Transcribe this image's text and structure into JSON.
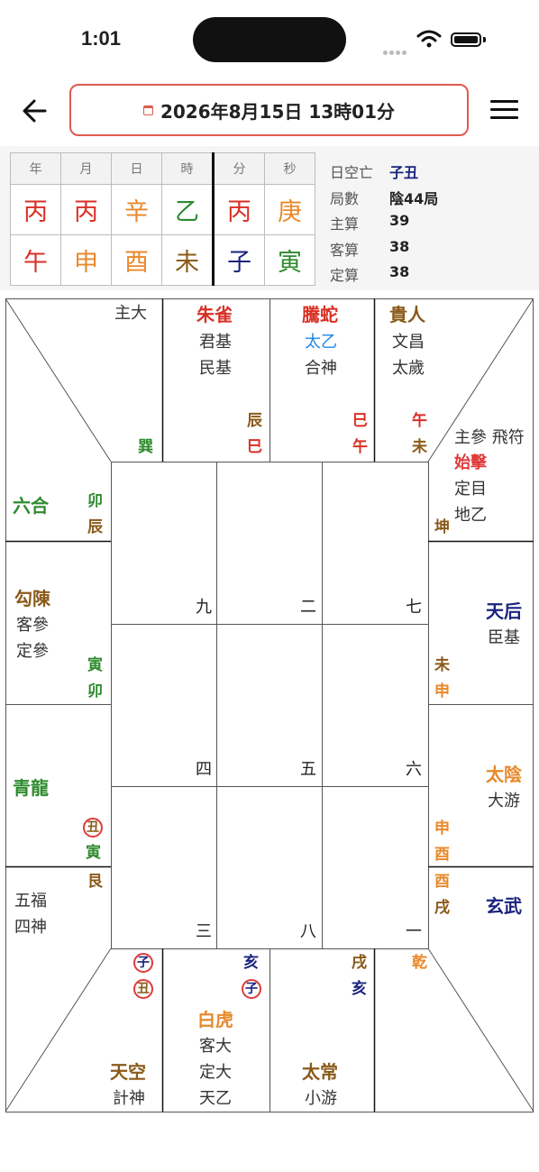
{
  "status_bar": {
    "time": "1:01"
  },
  "header": {
    "date_text": "2026年8月15日 13時01分"
  },
  "bazi": {
    "headers": [
      "年",
      "月",
      "日",
      "時",
      "分",
      "秒"
    ],
    "stems": [
      {
        "c": "丙",
        "color": "#d93025"
      },
      {
        "c": "丙",
        "color": "#d93025"
      },
      {
        "c": "辛",
        "color": "#e8892b"
      },
      {
        "c": "乙",
        "color": "#2e8b2e"
      },
      {
        "c": "丙",
        "color": "#d93025"
      },
      {
        "c": "庚",
        "color": "#e8892b"
      }
    ],
    "branches": [
      {
        "c": "午",
        "color": "#d93025"
      },
      {
        "c": "申",
        "color": "#e8892b"
      },
      {
        "c": "酉",
        "color": "#e8892b"
      },
      {
        "c": "未",
        "color": "#8a5a1a"
      },
      {
        "c": "子",
        "color": "#1a237e"
      },
      {
        "c": "寅",
        "color": "#2e8b2e"
      }
    ]
  },
  "info": [
    {
      "label": "日空亡",
      "value": "子丑",
      "color": "#1a237e"
    },
    {
      "label": "局數",
      "value": "陰44局",
      "color": "#222"
    },
    {
      "label": "主算",
      "value": "39",
      "color": "#222"
    },
    {
      "label": "客算",
      "value": "38",
      "color": "#222"
    },
    {
      "label": "定算",
      "value": "38",
      "color": "#222"
    }
  ],
  "colors": {
    "red": "#d93025",
    "orange": "#e8892b",
    "green": "#2e8b2e",
    "brown": "#8a5a1a",
    "navy": "#1a237e",
    "blue": "#1e88e5"
  },
  "palaces": {
    "p1": {
      "stars": [
        "主大"
      ],
      "branches": [
        "巽"
      ]
    },
    "p2": {
      "god": "朱雀",
      "stars": [
        "君基",
        "民基"
      ],
      "branches": [
        "辰",
        "巳"
      ]
    },
    "p3": {
      "god": "騰蛇",
      "star_blue": "太乙",
      "stars": [
        "合神"
      ],
      "branches": [
        "巳",
        "午"
      ]
    },
    "p4": {
      "god": "貴人",
      "stars": [
        "文昌",
        "太歲"
      ],
      "branches": [
        "午",
        "未"
      ]
    },
    "p5": {
      "stars": [
        "主參 飛符"
      ],
      "red_star": "始擊",
      "stars2": [
        "定目",
        "地乙"
      ],
      "branches": [
        "坤"
      ]
    },
    "p6": {
      "god": "六合",
      "branches": [
        "卯",
        "辰"
      ]
    },
    "p7": {
      "god": "天后",
      "stars": [
        "臣基"
      ],
      "branches": [
        "未",
        "申"
      ]
    },
    "p8": {
      "god": "勾陳",
      "stars": [
        "客參",
        "定參"
      ],
      "branches": [
        "寅",
        "卯"
      ]
    },
    "p9": {
      "god": "太陰",
      "stars": [
        "大游"
      ],
      "branches": [
        "申",
        "酉"
      ]
    },
    "p10": {
      "god": "青龍",
      "circle": "丑",
      "branches": [
        "寅"
      ]
    },
    "p11": {
      "god": "玄武",
      "branches": [
        "酉",
        "戌"
      ]
    },
    "p12": {
      "stars": [
        "五福",
        "四神"
      ],
      "branches": [
        "艮"
      ]
    },
    "p13": {
      "god": "天空",
      "stars": [
        "計神"
      ],
      "circles": [
        "子",
        "丑"
      ]
    },
    "p14": {
      "god": "白虎",
      "stars": [
        "客大",
        "定大",
        "天乙"
      ],
      "branch": "亥",
      "circle": "子"
    },
    "p15": {
      "god": "太常",
      "stars": [
        "小游"
      ],
      "branches": [
        "戌",
        "亥"
      ]
    },
    "p16": {
      "branches": [
        "乾"
      ]
    }
  },
  "numbers": {
    "r1": [
      "九",
      "二",
      "七"
    ],
    "r2": [
      "四",
      "五",
      "六"
    ],
    "r3": [
      "三",
      "八",
      "一"
    ]
  }
}
